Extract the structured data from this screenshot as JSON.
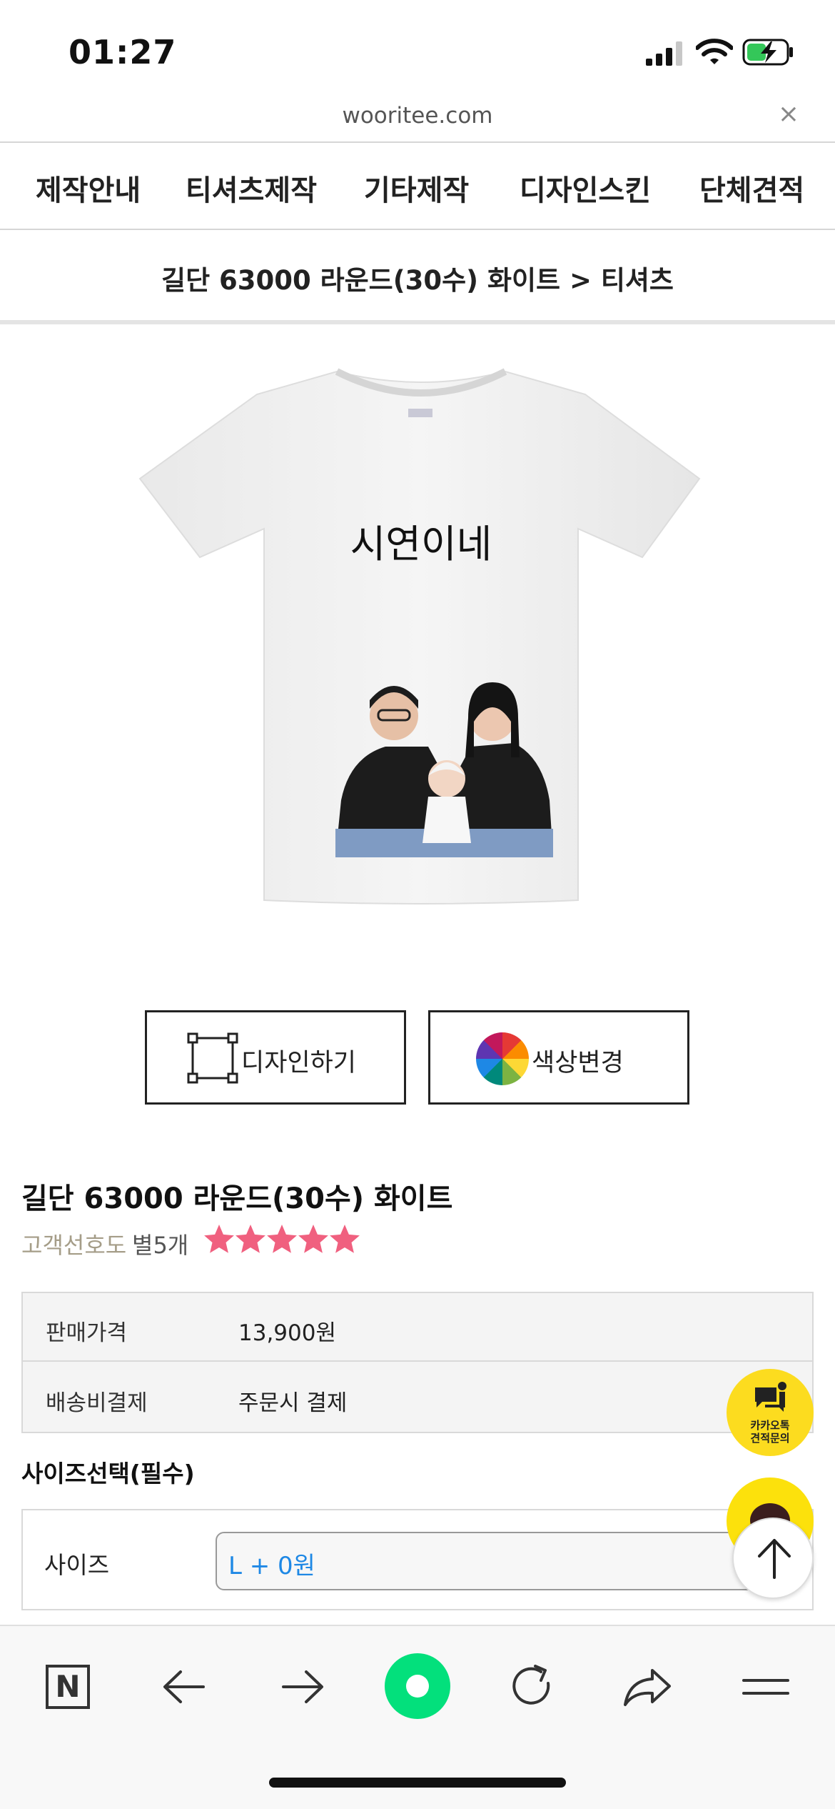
{
  "status_bar": {
    "time": "01:27"
  },
  "url_bar": {
    "url": "wooritee.com",
    "close_glyph": "×"
  },
  "nav": {
    "items": [
      {
        "label": "제작안내"
      },
      {
        "label": "티셔츠제작"
      },
      {
        "label": "기타제작"
      },
      {
        "label": "디자인스킨"
      },
      {
        "label": "단체견적"
      }
    ]
  },
  "breadcrumb": "길단 63000 라운드(30수) 화이트 > 티셔츠",
  "product_image": {
    "printed_text": "시연이네",
    "shirt_color": "#f2f2f2"
  },
  "actions": {
    "design_label": "디자인하기",
    "color_label": "색상변경"
  },
  "product": {
    "title": "길단 63000 라운드(30수) 화이트",
    "preference_label": "고객선호도",
    "preference_count": "별5개",
    "rating": 5,
    "star_color": "#f0607f"
  },
  "price": {
    "rows": [
      {
        "label": "판매가격",
        "value": "13,900원"
      },
      {
        "label": "배송비결제",
        "value": "주문시 결제"
      }
    ]
  },
  "size": {
    "heading": "사이즈선택(필수)",
    "label": "사이즈",
    "selected": "L  + 0원"
  },
  "floating": {
    "kakao_inquiry_text": "카카오톡\n견적문의",
    "kakao_color": "#fcdc1f"
  },
  "icons": {
    "toolbar": [
      "naver-icon",
      "back-arrow-icon",
      "forward-arrow-icon",
      "green-dot-icon",
      "refresh-icon",
      "share-icon",
      "menu-icon"
    ]
  }
}
